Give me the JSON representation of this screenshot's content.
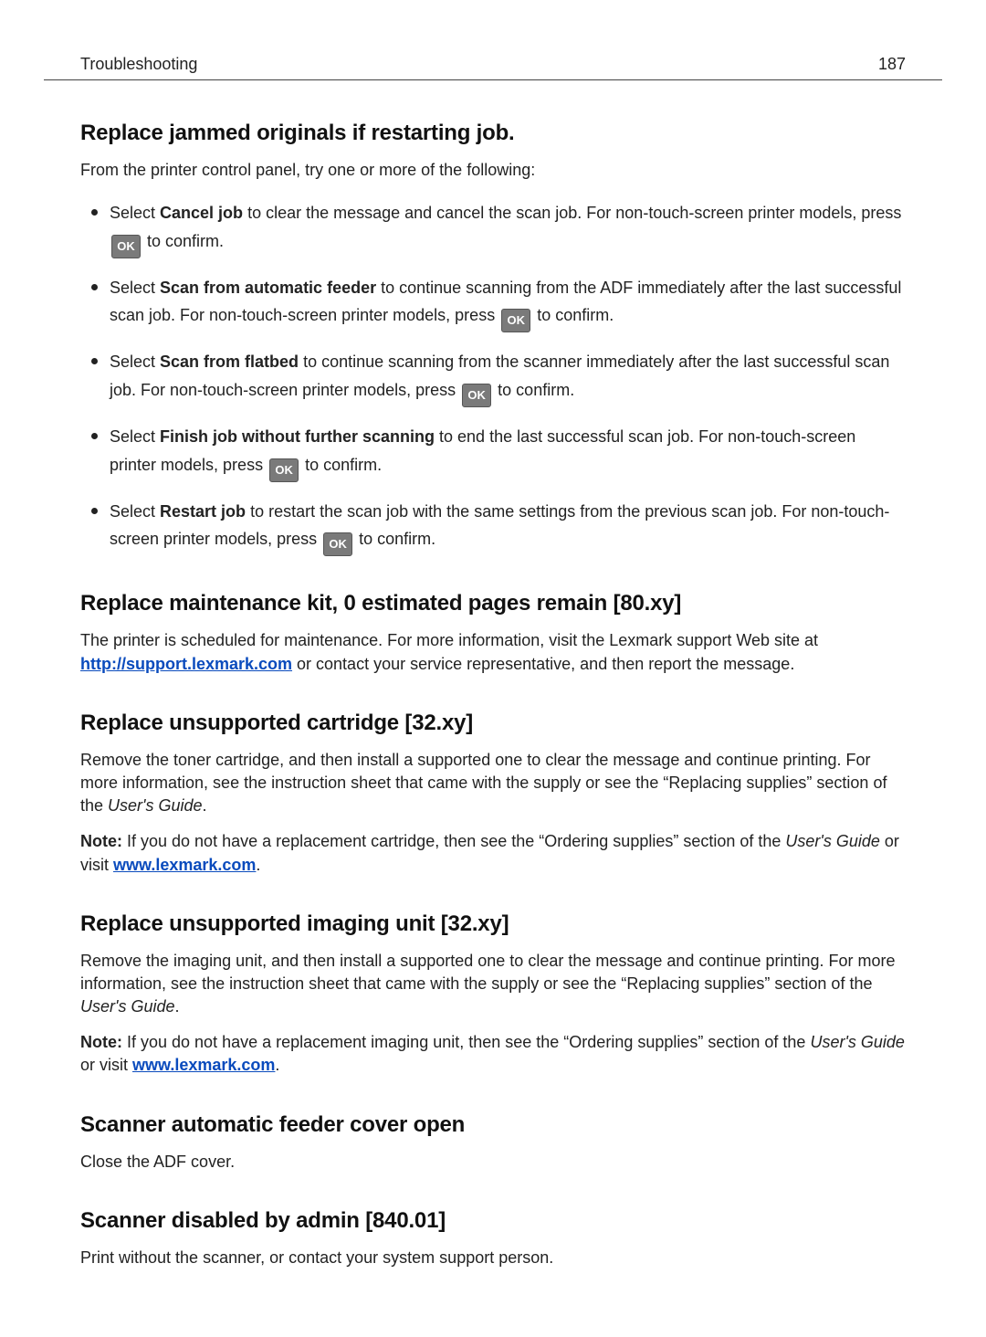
{
  "header": {
    "section": "Troubleshooting",
    "page_number": "187"
  },
  "ok_label": "OK",
  "sections": {
    "replace_jammed": {
      "heading": "Replace jammed originals if restarting job.",
      "intro": "From the printer control panel, try one or more of the following:",
      "items": {
        "cancel": {
          "pre": "Select ",
          "bold": "Cancel job",
          "mid": " to clear the message and cancel the scan job. For non-touch-screen printer models, press ",
          "post": " to confirm."
        },
        "scan_adf": {
          "pre": "Select ",
          "bold": "Scan from automatic feeder",
          "mid": " to continue scanning from the ADF immediately after the last successful scan job. For non-touch-screen printer models, press ",
          "post": " to confirm."
        },
        "scan_flatbed": {
          "pre": "Select ",
          "bold": "Scan from flatbed",
          "mid": " to continue scanning from the scanner immediately after the last successful scan job. For non-touch-screen printer models, press ",
          "post": " to confirm."
        },
        "finish": {
          "pre": "Select ",
          "bold": "Finish job without further scanning",
          "mid": " to end the last successful scan job. For non-touch-screen printer models, press ",
          "post": " to confirm."
        },
        "restart": {
          "pre": "Select ",
          "bold": "Restart job",
          "mid": " to restart the scan job with the same settings from the previous scan job. For non-touch-screen printer models, press ",
          "post": " to confirm."
        }
      }
    },
    "maintenance_kit": {
      "heading": "Replace maintenance kit, 0 estimated pages remain [80.xy]",
      "p1_pre": "The printer is scheduled for maintenance. For more information, visit the Lexmark support Web site at ",
      "link_text": "http://support.lexmark.com",
      "p1_post": " or contact your service representative, and then report the message."
    },
    "unsupported_cartridge": {
      "heading": "Replace unsupported cartridge [32.xy]",
      "p1_a": "Remove the toner cartridge, and then install a supported one to clear the message and continue printing. For more information, see the instruction sheet that came with the supply or see the “Replacing supplies” section of the ",
      "p1_italic": "User's Guide",
      "p1_b": ".",
      "note_label": "Note:",
      "note_a": " If you do not have a replacement cartridge, then see the “Ordering supplies” section of the ",
      "note_italic": "User's Guide",
      "note_b": " or visit ",
      "link_text": "www.lexmark.com",
      "note_c": "."
    },
    "unsupported_imaging": {
      "heading": "Replace unsupported imaging unit [32.xy]",
      "p1_a": "Remove the imaging unit, and then install a supported one to clear the message and continue printing. For more information, see the instruction sheet that came with the supply or see the “Replacing supplies” section of the ",
      "p1_italic": "User's Guide",
      "p1_b": ".",
      "note_label": "Note:",
      "note_a": " If you do not have a replacement imaging unit, then see the “Ordering supplies” section of the ",
      "note_italic": "User's Guide",
      "note_b": " or visit ",
      "link_text": "www.lexmark.com",
      "note_c": "."
    },
    "adf_cover": {
      "heading": "Scanner automatic feeder cover open",
      "p1": "Close the ADF cover."
    },
    "scanner_disabled": {
      "heading": "Scanner disabled by admin [840.01]",
      "p1": "Print without the scanner, or contact your system support person."
    }
  }
}
